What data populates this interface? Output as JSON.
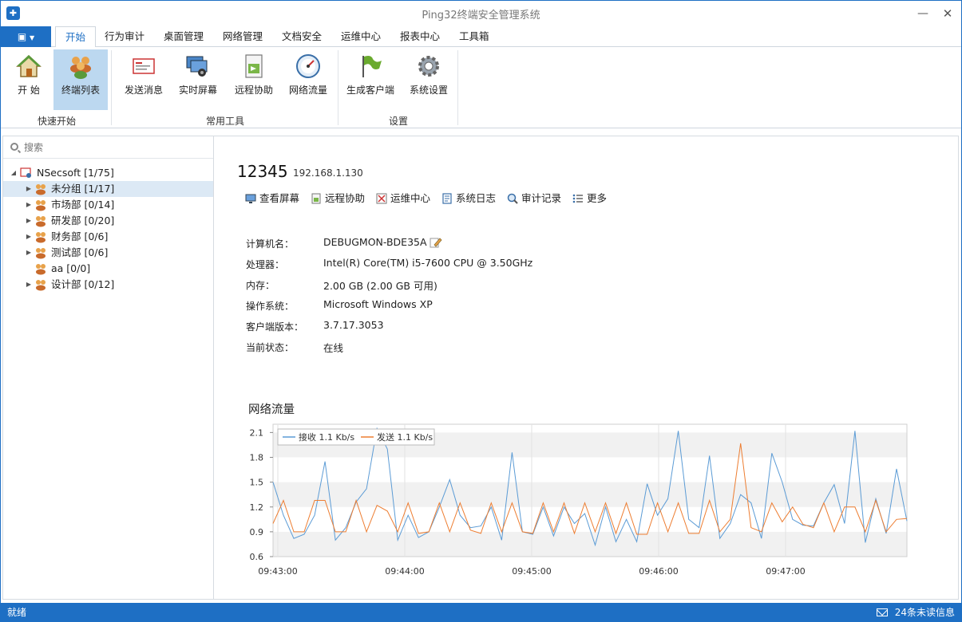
{
  "window": {
    "title": "Ping32终端安全管理系统"
  },
  "tabs": [
    "开始",
    "行为审计",
    "桌面管理",
    "网络管理",
    "文档安全",
    "运维中心",
    "报表中心",
    "工具箱"
  ],
  "ribbon": {
    "groups": [
      "快速开始",
      "常用工具",
      "设置"
    ],
    "buttons": [
      "开 始",
      "终端列表",
      "发送消息",
      "实时屏幕",
      "远程协助",
      "网络流量",
      "生成客户端",
      "系统设置"
    ]
  },
  "sidebar": {
    "search_placeholder": "搜索",
    "root": "NSecsoft  [1/75]",
    "items": [
      {
        "label": "未分组  [1/17]"
      },
      {
        "label": "市场部  [0/14]"
      },
      {
        "label": "研发部  [0/20]"
      },
      {
        "label": "财务部  [0/6]"
      },
      {
        "label": "测试部  [0/6]"
      },
      {
        "label": "aa  [0/0]"
      },
      {
        "label": "设计部  [0/12]"
      }
    ]
  },
  "host": {
    "name": "12345",
    "ip": "192.168.1.130",
    "actions": [
      "查看屏幕",
      "远程协助",
      "运维中心",
      "系统日志",
      "审计记录",
      "更多"
    ],
    "info": [
      {
        "label": "计算机名：",
        "value": "DEBUGMON-BDE35A"
      },
      {
        "label": "处理器：",
        "value": "Intel(R) Core(TM) i5-7600 CPU @ 3.50GHz"
      },
      {
        "label": "内存：",
        "value": "2.00 GB (2.00 GB 可用)"
      },
      {
        "label": "操作系统：",
        "value": "Microsoft Windows XP"
      },
      {
        "label": "客户端版本：",
        "value": "3.7.17.3053"
      },
      {
        "label": "当前状态：",
        "value": "在线"
      }
    ]
  },
  "chart_title": "网络流量",
  "chart_data": {
    "type": "line",
    "x_ticks": [
      "09:43:00",
      "09:44:00",
      "09:45:00",
      "09:46:00",
      "09:47:00"
    ],
    "y_ticks": [
      "0.6",
      "0.9",
      "1.2",
      "1.5",
      "1.8",
      "2.1"
    ],
    "ylim": [
      0.6,
      2.2
    ],
    "legend_position": "top-left",
    "series": [
      {
        "name": "接收 1.1 Kb/s",
        "color": "#5b9bd5",
        "values": [
          1.5,
          1.1,
          0.82,
          0.87,
          1.1,
          1.75,
          0.8,
          0.95,
          1.26,
          1.42,
          2.15,
          1.9,
          0.8,
          1.1,
          0.83,
          0.9,
          1.2,
          1.53,
          1.1,
          0.95,
          0.97,
          1.2,
          0.8,
          1.86,
          0.9,
          0.87,
          1.2,
          0.85,
          1.2,
          1.0,
          1.12,
          0.74,
          1.2,
          0.78,
          1.05,
          0.78,
          1.48,
          1.1,
          1.3,
          2.12,
          1.05,
          0.95,
          1.82,
          0.82,
          1.0,
          1.35,
          1.25,
          0.82,
          1.85,
          1.5,
          1.05,
          0.98,
          0.97,
          1.25,
          1.47,
          1.0,
          2.12,
          0.77,
          1.3,
          0.88,
          1.66,
          1.03
        ]
      },
      {
        "name": "发送 1.1 Kb/s",
        "color": "#ed7d31",
        "values": [
          1.0,
          1.28,
          0.9,
          0.9,
          1.28,
          1.28,
          0.9,
          0.9,
          1.28,
          0.9,
          1.22,
          1.15,
          0.9,
          1.25,
          0.88,
          0.9,
          1.25,
          0.9,
          1.25,
          0.92,
          0.88,
          1.25,
          0.9,
          1.25,
          0.9,
          0.88,
          1.25,
          0.9,
          1.25,
          0.88,
          1.25,
          0.9,
          1.25,
          0.88,
          1.25,
          0.87,
          0.87,
          1.25,
          0.9,
          1.25,
          0.88,
          0.88,
          1.28,
          0.9,
          1.05,
          1.97,
          0.95,
          0.9,
          1.25,
          1.02,
          1.2,
          0.99,
          0.95,
          1.25,
          0.9,
          1.2,
          1.2,
          0.9,
          1.28,
          0.9,
          1.05,
          1.06
        ]
      }
    ]
  },
  "status": {
    "left": "就绪",
    "right": "24条未读信息"
  }
}
